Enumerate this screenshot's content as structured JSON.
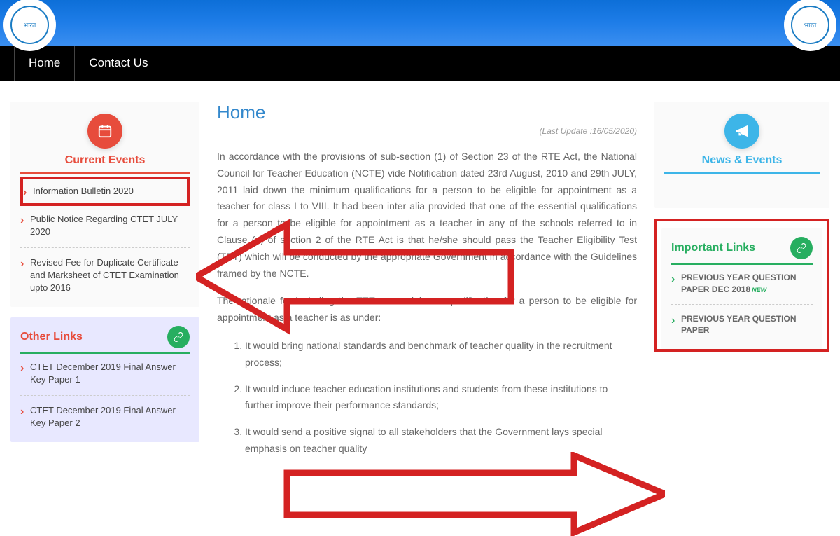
{
  "header": {
    "logo_text": "भारत"
  },
  "nav": {
    "home": "Home",
    "contact": "Contact Us"
  },
  "sidebar_left": {
    "current_events": {
      "title": "Current Events",
      "items": [
        "Information Bulletin 2020",
        "Public Notice Regarding CTET JULY 2020",
        "Revised Fee for Duplicate Certificate and Marksheet of CTET Examination upto 2016"
      ]
    },
    "other_links": {
      "title": "Other Links",
      "items": [
        "CTET December 2019 Final Answer Key Paper 1",
        "CTET December 2019 Final Answer Key Paper 2"
      ]
    }
  },
  "main": {
    "title": "Home",
    "last_update": "(Last Update :16/05/2020)",
    "para1": "In accordance with the provisions of sub-section (1) of Section 23 of the RTE Act, the National Council for Teacher Education (NCTE) vide Notification dated 23rd August, 2010 and 29th JULY, 2011 laid down the minimum qualifications for a person to be eligible for appointment as a teacher for class I to VIII.  It had been inter alia provided that one of the essential qualifications for a person to be eligible for appointment as a teacher in any of the schools referred to in Clause (n) of section 2 of the RTE Act is that he/she should pass the Teacher Eligibility Test (TET) which will be conducted by the appropriate Government in accordance with the Guidelines framed by the NCTE.",
    "para2": "The rationale for including the TET as a minimum qualification for a person to be eligible for appointment as a teacher is as under:",
    "list": [
      "It would bring national standards and benchmark of teacher quality in the recruitment process;",
      "It would induce teacher education institutions and students from these institutions to further improve their performance standards;",
      "It would send a positive signal to all stakeholders that the Government lays special emphasis on teacher quality"
    ]
  },
  "sidebar_right": {
    "news_events": {
      "title": "News & Events"
    },
    "important_links": {
      "title": "Important Links",
      "items": [
        "PREVIOUS YEAR QUESTION PAPER DEC 2018",
        "PREVIOUS YEAR QUESTION PAPER"
      ],
      "new_label": "NEW"
    }
  }
}
